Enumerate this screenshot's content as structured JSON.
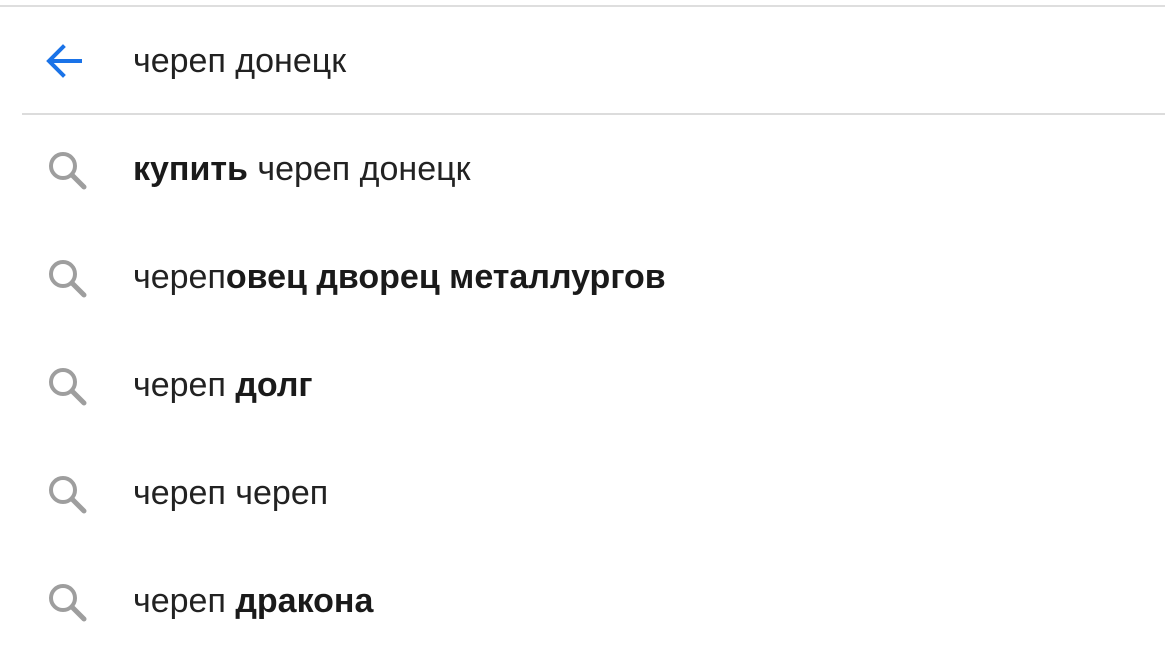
{
  "search": {
    "query": "череп донецк",
    "back_icon": "arrow-left-icon",
    "accent_color": "#1a73e8"
  },
  "suggestions": [
    {
      "icon": "search-icon",
      "segments": [
        {
          "text": "купить",
          "bold": true
        },
        {
          "text": " череп донецк",
          "bold": false
        }
      ]
    },
    {
      "icon": "search-icon",
      "segments": [
        {
          "text": "череп",
          "bold": false
        },
        {
          "text": "овец дворец металлургов",
          "bold": true
        }
      ]
    },
    {
      "icon": "search-icon",
      "segments": [
        {
          "text": "череп ",
          "bold": false
        },
        {
          "text": "долг",
          "bold": true
        }
      ]
    },
    {
      "icon": "search-icon",
      "segments": [
        {
          "text": "череп череп",
          "bold": false
        }
      ]
    },
    {
      "icon": "search-icon",
      "segments": [
        {
          "text": "череп ",
          "bold": false
        },
        {
          "text": "дракона",
          "bold": true
        }
      ]
    }
  ]
}
